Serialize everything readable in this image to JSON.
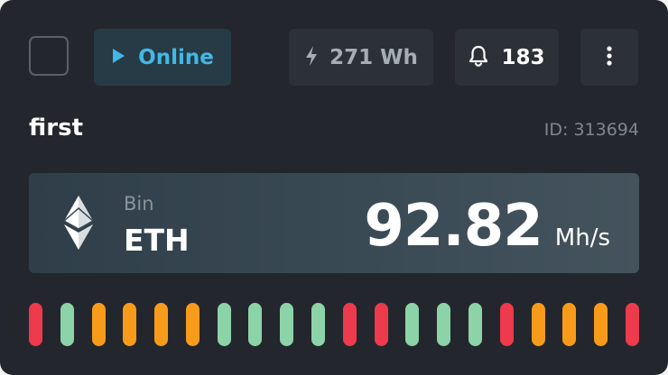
{
  "header": {
    "status_label": "Online",
    "power_label": "271 Wh",
    "alerts_count": "183"
  },
  "rig": {
    "name": "first",
    "id_label": "ID: 313694"
  },
  "mining": {
    "pool": "Bin",
    "coin": "ETH",
    "hashrate": "92.82",
    "hashrate_unit": "Mh/s"
  },
  "colors": {
    "online_accent": "#43b7e6",
    "gpu_red": "#ed3a4c",
    "gpu_green": "#8dd3a8",
    "gpu_orange": "#f99b1a"
  },
  "icons": [
    "play-icon",
    "lightning-icon",
    "bell-icon",
    "more-vertical-icon",
    "ethereum-icon"
  ],
  "gpu_statuses": [
    "red",
    "green",
    "orange",
    "orange",
    "orange",
    "orange",
    "green",
    "green",
    "green",
    "green",
    "red",
    "red",
    "green",
    "green",
    "green",
    "red",
    "orange",
    "orange",
    "orange",
    "red"
  ]
}
